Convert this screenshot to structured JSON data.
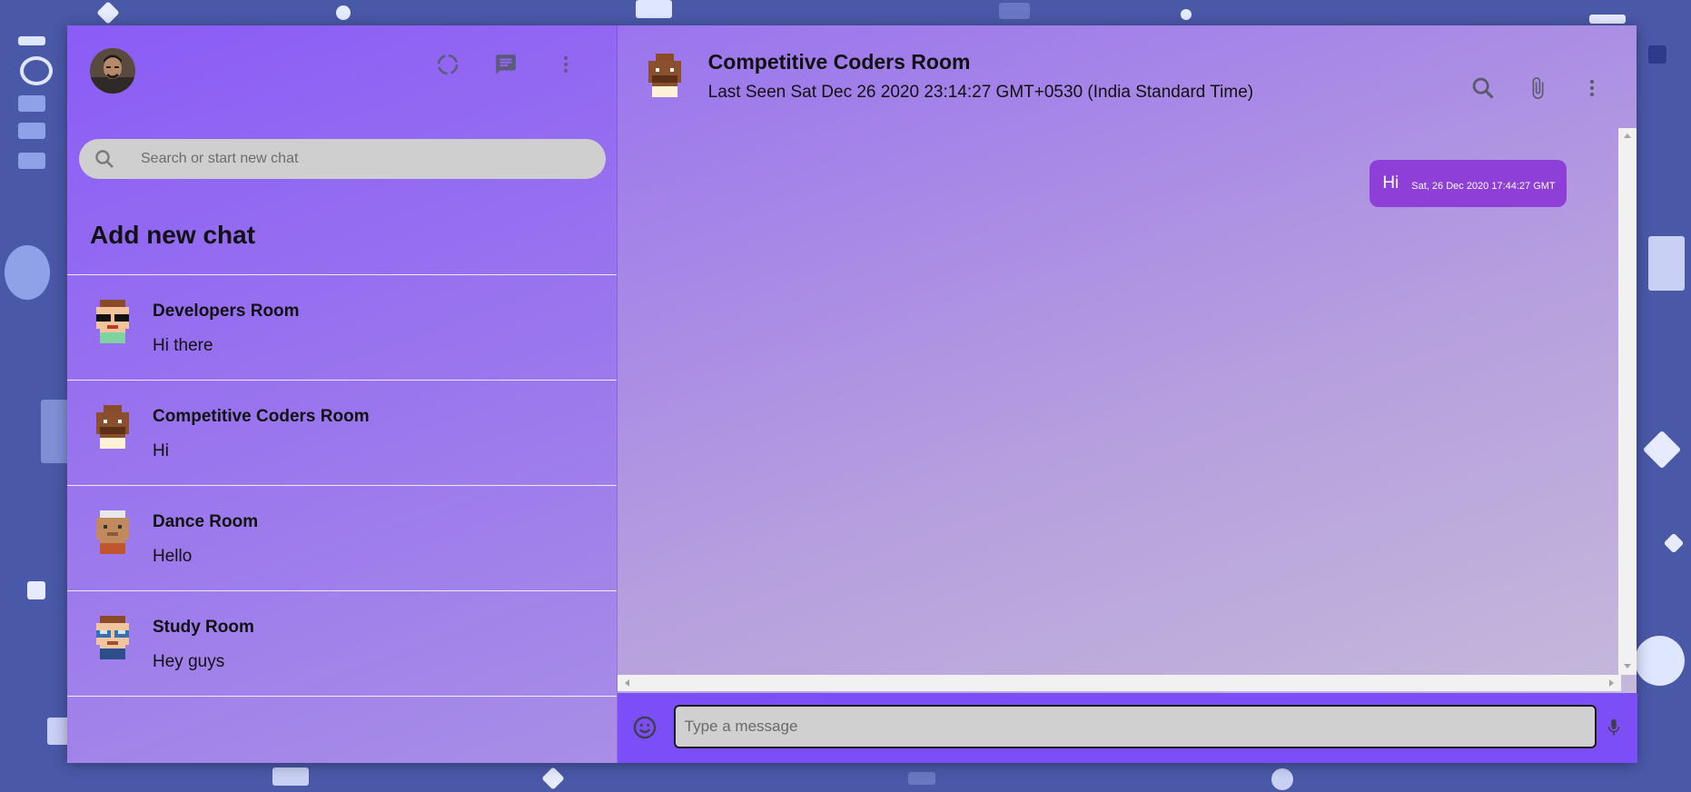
{
  "sidebar": {
    "search": {
      "placeholder": "Search or start new chat",
      "value": ""
    },
    "add_new_chat_label": "Add new chat",
    "chats": [
      {
        "name": "Developers Room",
        "last_message": "Hi there"
      },
      {
        "name": "Competitive Coders Room",
        "last_message": "Hi"
      },
      {
        "name": "Dance Room",
        "last_message": "Hello"
      },
      {
        "name": "Study Room",
        "last_message": "Hey guys"
      }
    ]
  },
  "chat": {
    "room_name": "Competitive Coders Room",
    "last_seen": "Last Seen Sat Dec 26 2020 23:14:27 GMT+0530 (India Standard Time)",
    "messages": [
      {
        "text": "Hi",
        "timestamp": "Sat, 26 Dec 2020 17:44:27 GMT"
      }
    ],
    "input": {
      "placeholder": "Type a message",
      "value": ""
    }
  },
  "icons": {
    "sidebar_header": [
      "status-icon",
      "chat-icon",
      "more-vert-icon"
    ],
    "chat_header": [
      "search-icon",
      "attach-icon",
      "more-vert-icon"
    ],
    "footer": [
      "emoji-icon",
      "mic-icon"
    ]
  },
  "colors": {
    "sidebar_gradient_start": "#8b5cf6",
    "footer_bg": "#7b4ef7",
    "bubble_bg": "#8e3fd8",
    "desktop_bg": "#4a58a8"
  }
}
